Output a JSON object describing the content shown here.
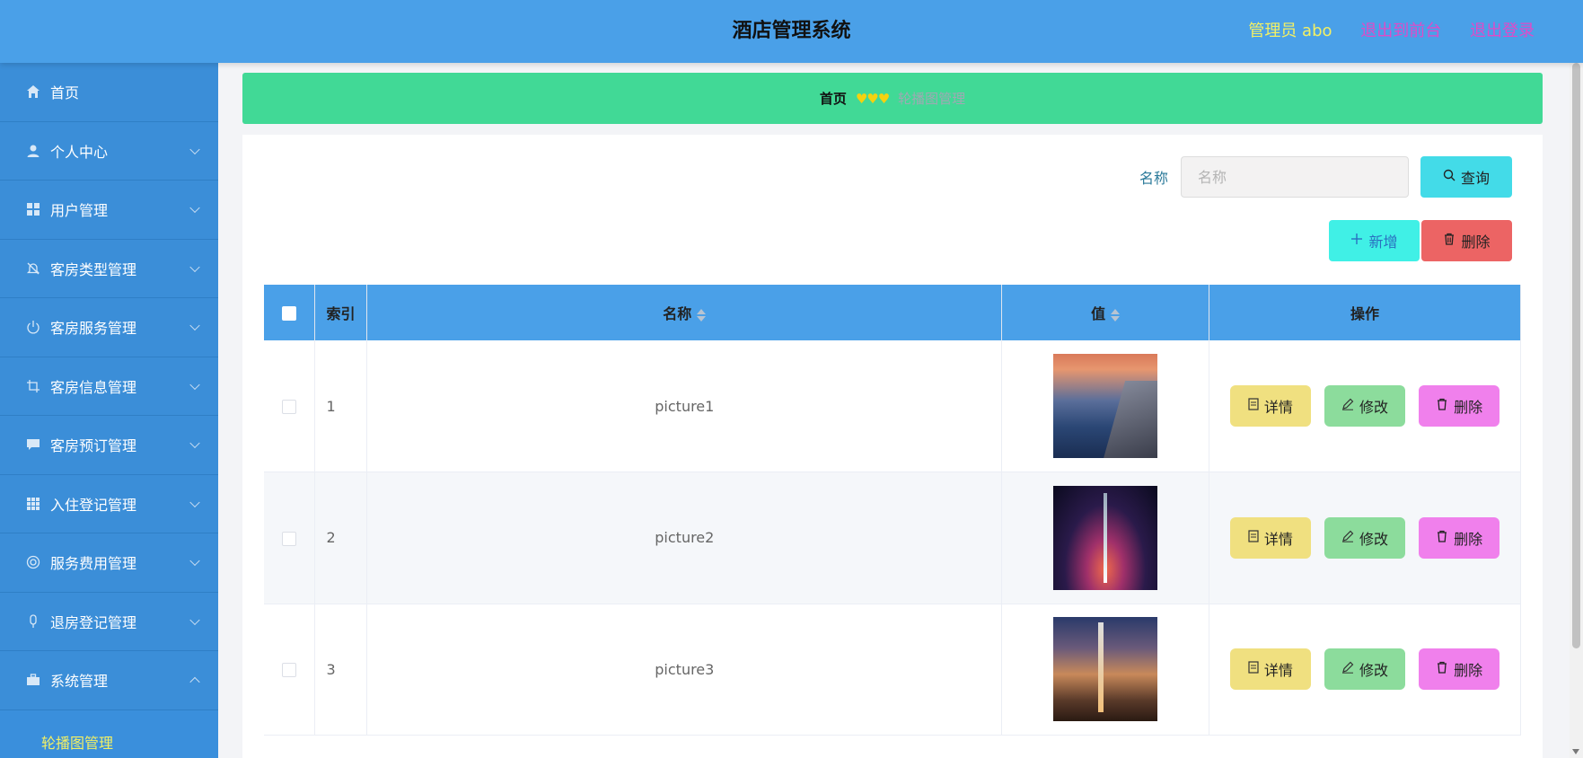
{
  "header": {
    "title": "酒店管理系统",
    "admin": "管理员 abo",
    "exit_front": "退出到前台",
    "logout": "退出登录"
  },
  "sidebar": {
    "items": [
      {
        "label": "首页",
        "icon": "home-icon"
      },
      {
        "label": "个人中心",
        "icon": "user-icon"
      },
      {
        "label": "用户管理",
        "icon": "grid-icon"
      },
      {
        "label": "客房类型管理",
        "icon": "bell-icon"
      },
      {
        "label": "客房服务管理",
        "icon": "power-icon"
      },
      {
        "label": "客房信息管理",
        "icon": "crop-icon"
      },
      {
        "label": "客房预订管理",
        "icon": "chat-icon"
      },
      {
        "label": "入住登记管理",
        "icon": "apps-icon"
      },
      {
        "label": "服务费用管理",
        "icon": "lifebuoy-icon"
      },
      {
        "label": "退房登记管理",
        "icon": "mic-icon"
      },
      {
        "label": "系统管理",
        "icon": "briefcase-icon"
      }
    ],
    "submenu_active": "轮播图管理"
  },
  "breadcrumb": {
    "home": "首页",
    "separator": "♥♥♥",
    "current": "轮播图管理"
  },
  "search": {
    "label": "名称",
    "placeholder": "名称",
    "button": "查询"
  },
  "actions": {
    "add": "新增",
    "delete": "删除"
  },
  "table": {
    "headers": {
      "index": "索引",
      "name": "名称",
      "value": "值",
      "operation": "操作"
    },
    "rows": [
      {
        "index": "1",
        "name": "picture1"
      },
      {
        "index": "2",
        "name": "picture2"
      },
      {
        "index": "3",
        "name": "picture3"
      }
    ],
    "row_buttons": {
      "detail": "详情",
      "edit": "修改",
      "delete": "删除"
    }
  },
  "colors": {
    "header_bg": "#4aa0e8",
    "sidebar_bg": "#3b8ed8",
    "breadcrumb_bg": "#41d996",
    "admin_text": "#f3f064",
    "link_text": "#e04ac8"
  }
}
